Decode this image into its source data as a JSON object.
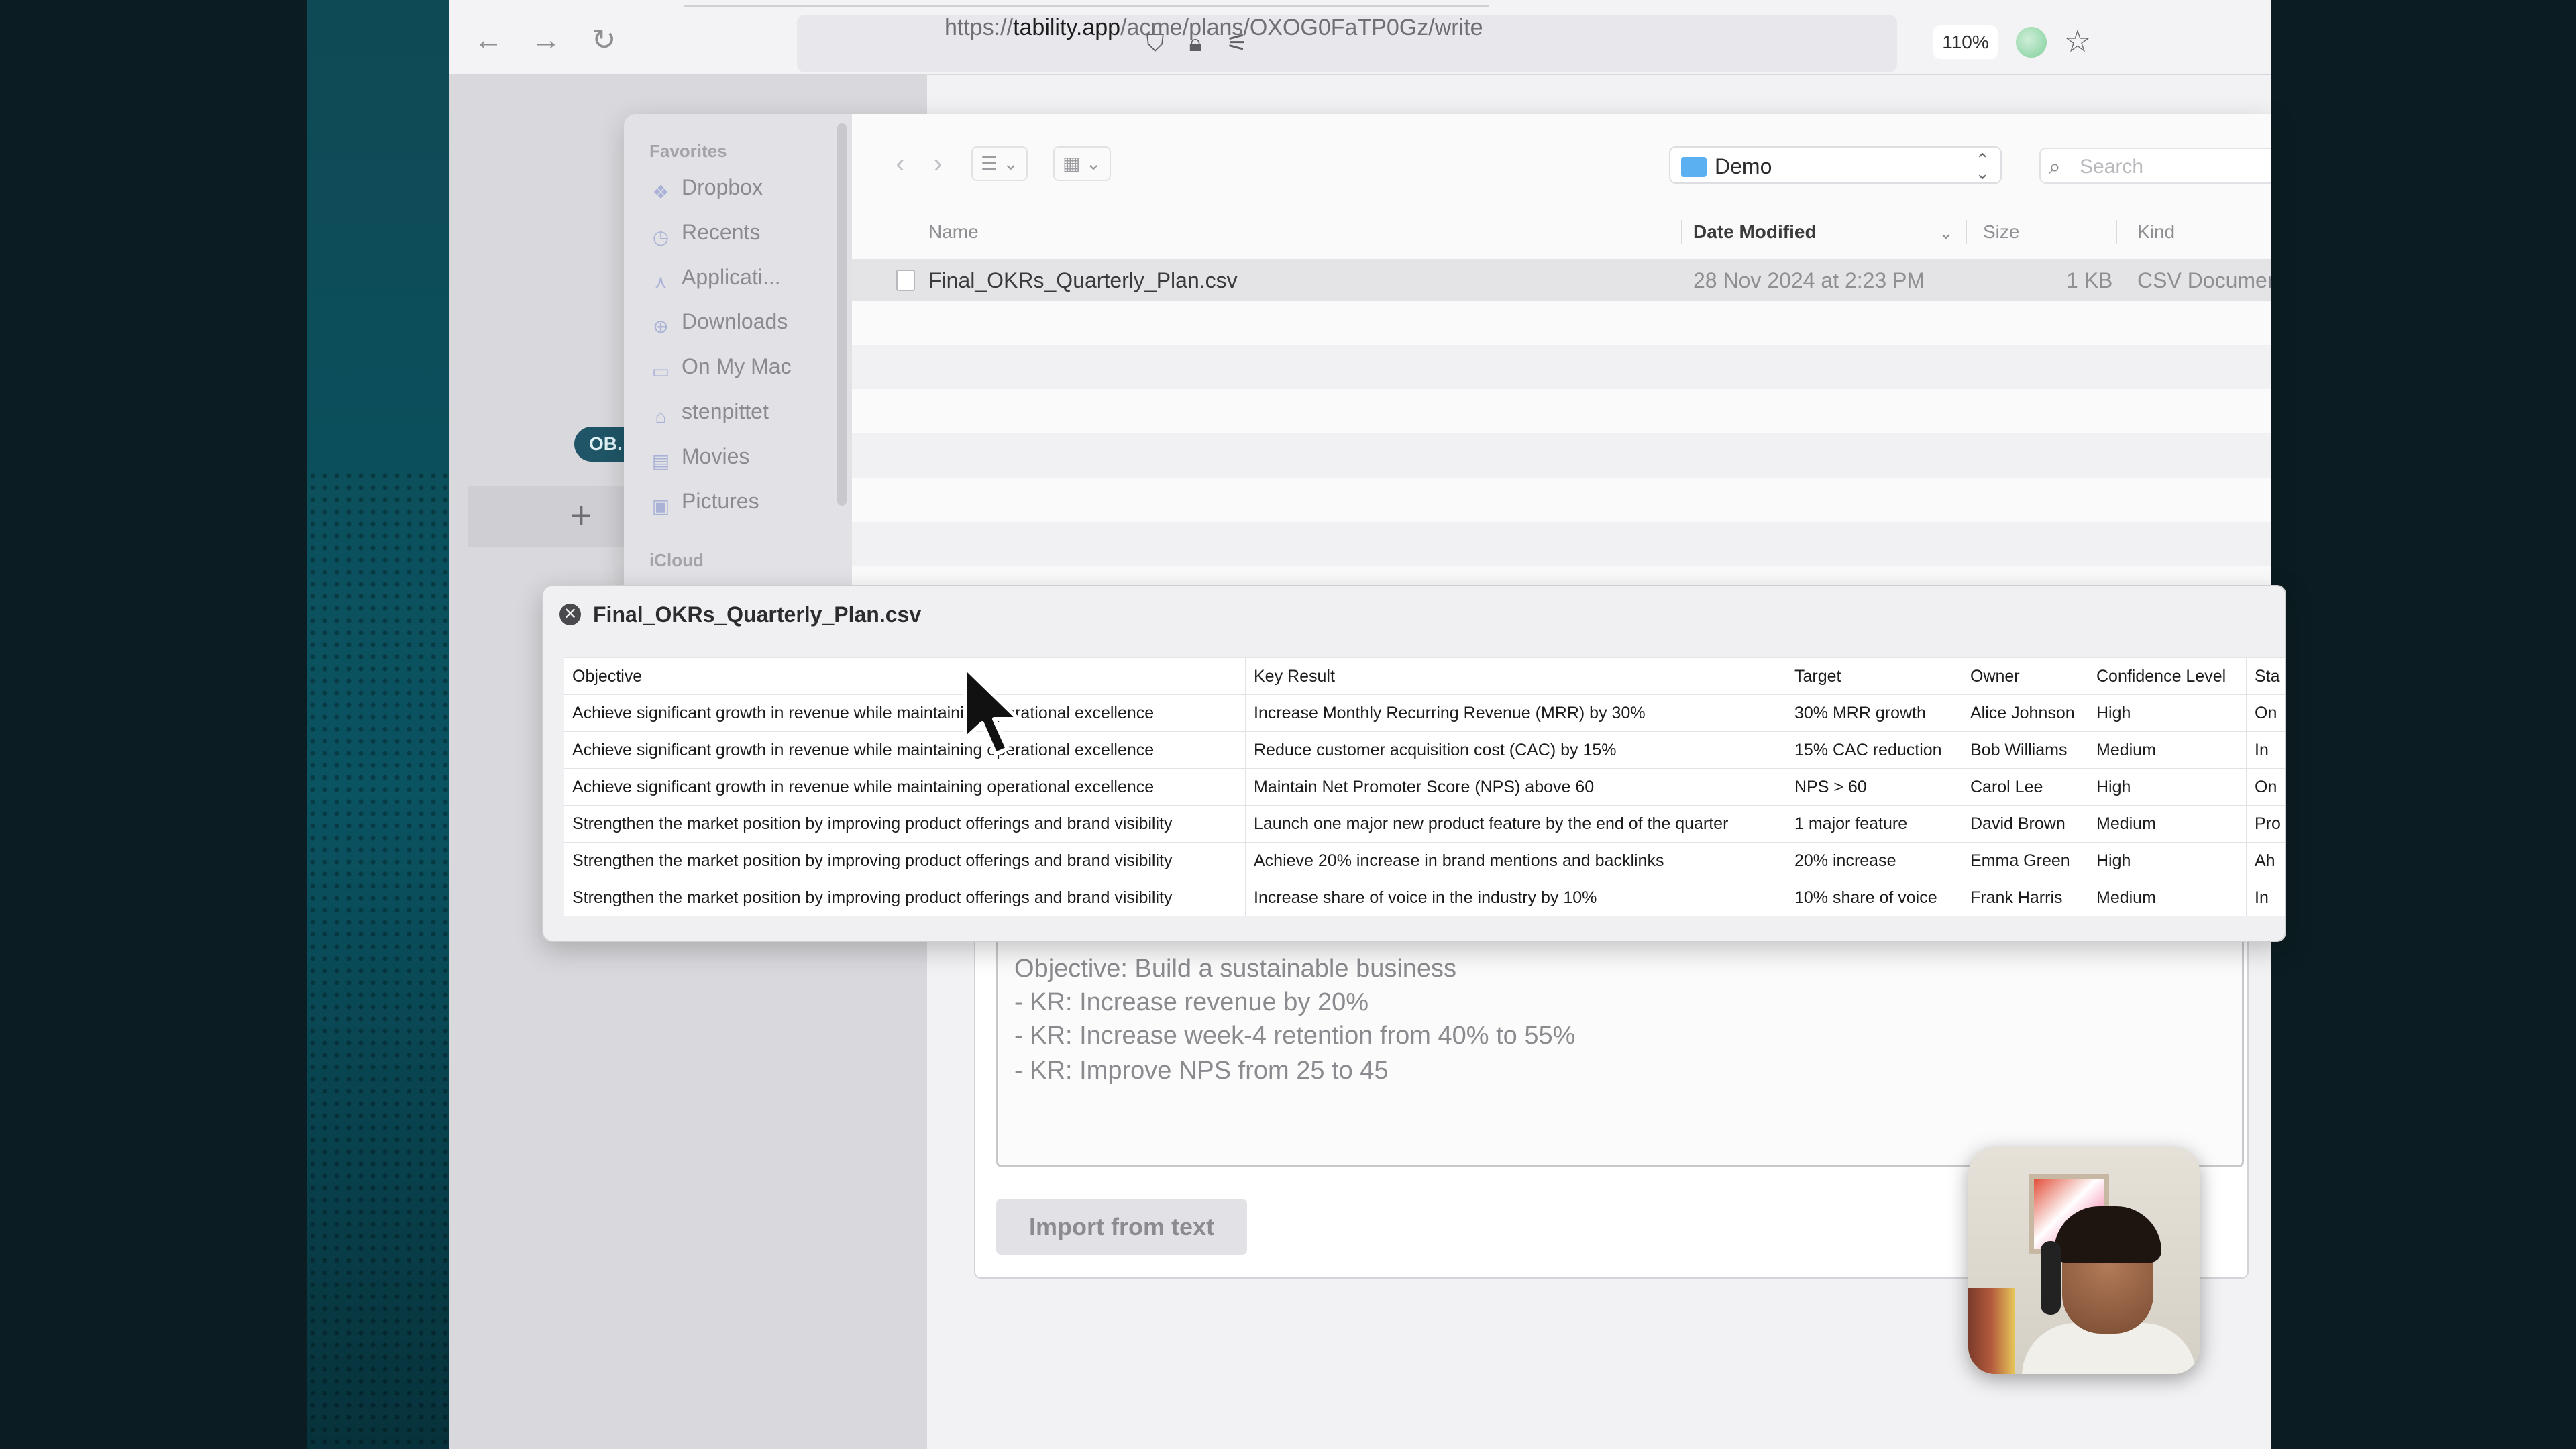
{
  "browser": {
    "url_prefix": "https://",
    "url_host": "tability.app",
    "url_path": "/acme/plans/OXOG0FaTP0Gz/write",
    "zoom": "110%"
  },
  "app": {
    "objective_pill": "OB.",
    "import_text_lines": [
      "Objective: Build a sustainable business",
      "- KR: Increase revenue by 20%",
      "- KR: Increase week-4 retention from 40% to 55%",
      "- KR: Improve NPS from 25 to 45"
    ],
    "import_button": "Import from text"
  },
  "finder": {
    "sidebar": {
      "favorites_label": "Favorites",
      "items": [
        "Dropbox",
        "Recents",
        "Applicati...",
        "Downloads",
        "On My Mac",
        "stenpittet",
        "Movies",
        "Pictures"
      ],
      "icloud_label": "iCloud"
    },
    "location": "Demo",
    "search_placeholder": "Search",
    "columns": {
      "name": "Name",
      "date_modified": "Date Modified",
      "size": "Size",
      "kind": "Kind"
    },
    "file": {
      "name": "Final_OKRs_Quarterly_Plan.csv",
      "date": "28 Nov 2024 at 2:23 PM",
      "size": "1 KB",
      "kind": "CSV Document"
    }
  },
  "quicklook": {
    "title": "Final_OKRs_Quarterly_Plan.csv",
    "headers": [
      "Objective",
      "Key Result",
      "Target",
      "Owner",
      "Confidence Level",
      "Sta"
    ],
    "rows": [
      [
        "Achieve significant growth in revenue while maintaining operational excellence",
        "Increase Monthly Recurring Revenue (MRR) by 30%",
        "30% MRR growth",
        "Alice Johnson",
        "High",
        "On"
      ],
      [
        "Achieve significant growth in revenue while maintaining operational excellence",
        "Reduce customer acquisition cost (CAC) by 15%",
        "15% CAC reduction",
        "Bob Williams",
        "Medium",
        "In"
      ],
      [
        "Achieve significant growth in revenue while maintaining operational excellence",
        "Maintain Net Promoter Score (NPS) above 60",
        "NPS > 60",
        "Carol Lee",
        "High",
        "On"
      ],
      [
        "Strengthen the market position by improving product offerings and brand visibility",
        "Launch one major new product feature by the end of the quarter",
        "1 major feature",
        "David Brown",
        "Medium",
        "Pro"
      ],
      [
        "Strengthen the market position by improving product offerings and brand visibility",
        "Achieve 20% increase in brand mentions and backlinks",
        "20% increase",
        "Emma Green",
        "High",
        "Ah"
      ],
      [
        "Strengthen the market position by improving product offerings and brand visibility",
        "Increase share of voice in the industry by 10%",
        "10% share of voice",
        "Frank Harris",
        "Medium",
        "In"
      ]
    ]
  }
}
